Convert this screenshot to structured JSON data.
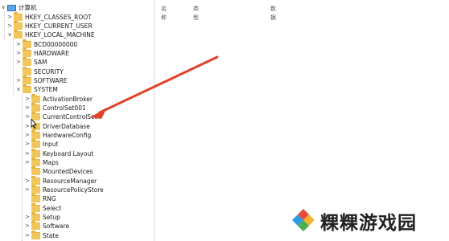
{
  "columns": {
    "name": "名称",
    "type": "类型",
    "data": "数据"
  },
  "tree": [
    {
      "label": "计算机",
      "chevron": "∨",
      "icon": "computer"
    },
    {
      "label": "HKEY_CLASSES_ROOT",
      "chevron": ">",
      "icon": "folder"
    },
    {
      "label": "HKEY_CURRENT_USER",
      "chevron": ">",
      "icon": "folder"
    },
    {
      "label": "HKEY_LOCAL_MACHINE",
      "chevron": "∨",
      "icon": "folder"
    },
    {
      "label": "BCD00000000",
      "chevron": ">",
      "icon": "folder"
    },
    {
      "label": "HARDWARE",
      "chevron": ">",
      "icon": "folder"
    },
    {
      "label": "SAM",
      "chevron": ">",
      "icon": "folder"
    },
    {
      "label": "SECURITY",
      "chevron": "",
      "icon": "folder"
    },
    {
      "label": "SOFTWARE",
      "chevron": ">",
      "icon": "folder"
    },
    {
      "label": "SYSTEM",
      "chevron": "∨",
      "icon": "folder"
    },
    {
      "label": "ActivationBroker",
      "chevron": ">",
      "icon": "folder"
    },
    {
      "label": "ControlSet001",
      "chevron": ">",
      "icon": "folder"
    },
    {
      "label": "CurrentControlSet",
      "chevron": ">",
      "icon": "folder"
    },
    {
      "label": "DriverDatabase",
      "chevron": ">",
      "icon": "folder"
    },
    {
      "label": "HardwareConfig",
      "chevron": ">",
      "icon": "folder"
    },
    {
      "label": "Input",
      "chevron": ">",
      "icon": "folder"
    },
    {
      "label": "Keyboard Layout",
      "chevron": ">",
      "icon": "folder"
    },
    {
      "label": "Maps",
      "chevron": ">",
      "icon": "folder"
    },
    {
      "label": "MountedDevices",
      "chevron": "",
      "icon": "folder"
    },
    {
      "label": "ResourceManager",
      "chevron": ">",
      "icon": "folder"
    },
    {
      "label": "ResourcePolicyStore",
      "chevron": ">",
      "icon": "folder"
    },
    {
      "label": "RNG",
      "chevron": "",
      "icon": "folder"
    },
    {
      "label": "Select",
      "chevron": "",
      "icon": "folder"
    },
    {
      "label": "Setup",
      "chevron": ">",
      "icon": "folder"
    },
    {
      "label": "Software",
      "chevron": ">",
      "icon": "folder"
    },
    {
      "label": "State",
      "chevron": ">",
      "icon": "folder"
    }
  ],
  "annotation": {
    "arrow_color": "#e0432c",
    "points_to": "CurrentControlSet"
  },
  "watermark": {
    "text": "粿粿游戏园",
    "logo_colors": [
      "#e84a3b",
      "#f5b335",
      "#4bb04f",
      "#2f9be0"
    ]
  }
}
